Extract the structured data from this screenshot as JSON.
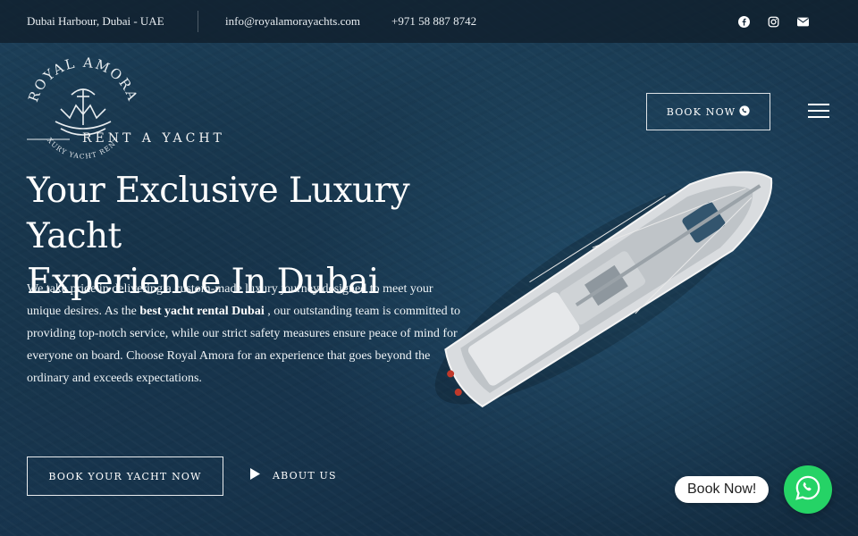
{
  "topbar": {
    "location": "Dubai Harbour, Dubai - UAE",
    "email": "info@royalamorayachts.com",
    "phone": "+971 58 887 8742",
    "social_icons": [
      "facebook-icon",
      "instagram-icon",
      "envelope-icon"
    ]
  },
  "logo": {
    "brand_top": "ROYAL AMORA",
    "brand_bottom": "LUXURY YACHT RENTAL",
    "tagline": "RENT A YACHT"
  },
  "header": {
    "book_now_label": "BOOK NOW",
    "book_now_icon": "whatsapp-icon",
    "menu_icon": "hamburger-icon"
  },
  "hero": {
    "headline_line1": "Your Exclusive Luxury Yacht",
    "headline_line2": "Experience In Dubai",
    "intro_before": "We take pride in delivering a custom-made luxury journey designed to meet your unique desires. As the ",
    "intro_bold": "best yacht rental Dubai",
    "intro_after": " , our outstanding team is committed to providing top-notch service, while our strict safety measures ensure peace of mind for everyone on board. Choose Royal Amora for an experience that goes beyond the ordinary and exceeds expectations.",
    "cta_primary": "BOOK YOUR YACHT NOW",
    "cta_secondary": "ABOUT US"
  },
  "chat_widget": {
    "label": "Book Now!",
    "icon": "whatsapp-icon",
    "color": "#25d366"
  },
  "colors": {
    "sea": "#1a3b53",
    "topbar": "#101e2a",
    "text": "#ffffff"
  }
}
